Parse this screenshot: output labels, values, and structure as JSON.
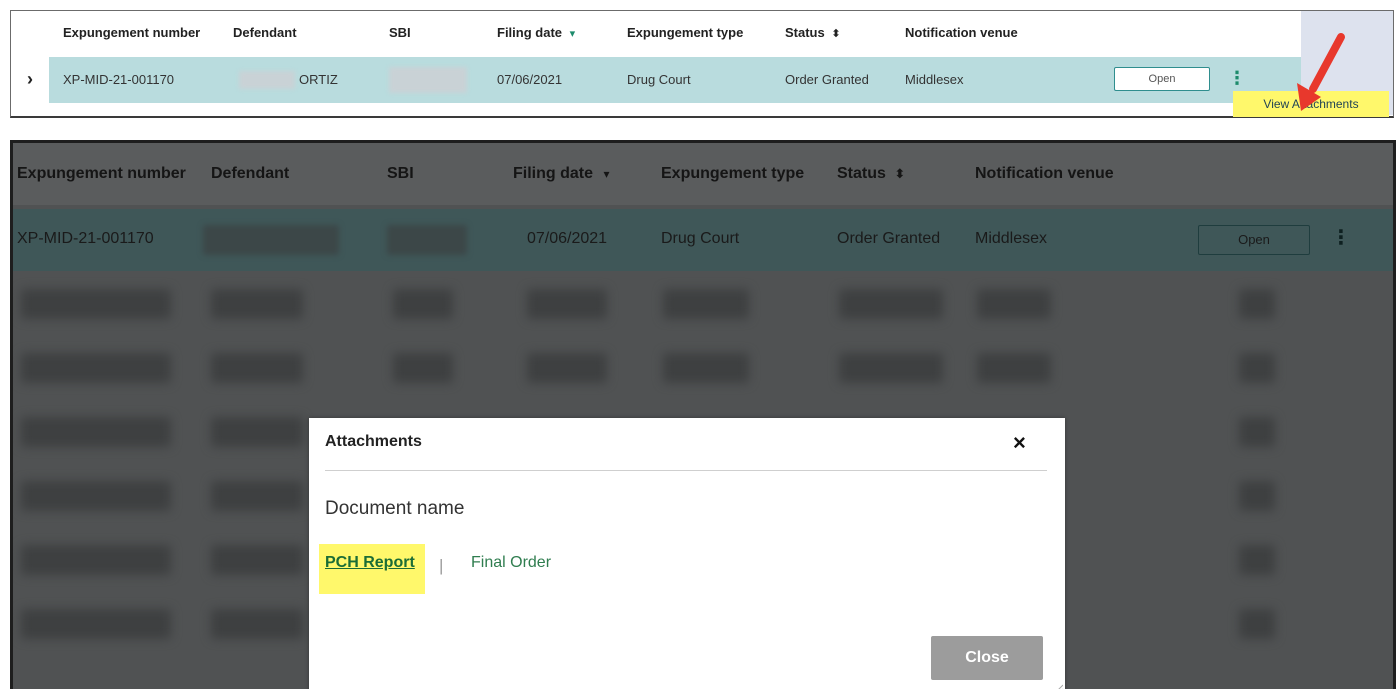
{
  "columns": [
    "Expungement number",
    "Defendant",
    "SBI",
    "Filing date",
    "Expungement type",
    "Status",
    "Notification venue"
  ],
  "icons": {
    "filing_sort": "chevron-down-icon",
    "status_sort": "sort-updown-icon",
    "expand": "chevron-right-icon",
    "kebab": "kebab-menu-icon",
    "close": "close-icon",
    "arrow": "red-arrow-icon"
  },
  "top_table": {
    "row": {
      "number": "XP-MID-21-001170",
      "defendant": "ORTIZ",
      "filing_date": "07/06/2021",
      "type": "Drug Court",
      "status": "Order Granted",
      "venue": "Middlesex",
      "open_label": "Open"
    },
    "menu_item": "View Attachments"
  },
  "bottom_table": {
    "row": {
      "number": "XP-MID-21-001170",
      "filing_date": "07/06/2021",
      "type": "Drug Court",
      "status": "Order Granted",
      "venue": "Middlesex",
      "open_label": "Open"
    }
  },
  "modal": {
    "title": "Attachments",
    "close_x": "×",
    "doc_label": "Document name",
    "links": [
      "PCH Report",
      "Final Order"
    ],
    "separator": "|",
    "close_button": "Close"
  },
  "colors": {
    "row_highlight": "#b9dcde",
    "overlay": "#505253",
    "yellow_highlight": "#fff86b",
    "arrow": "#e8382c",
    "link_green": "#1b6d36"
  }
}
